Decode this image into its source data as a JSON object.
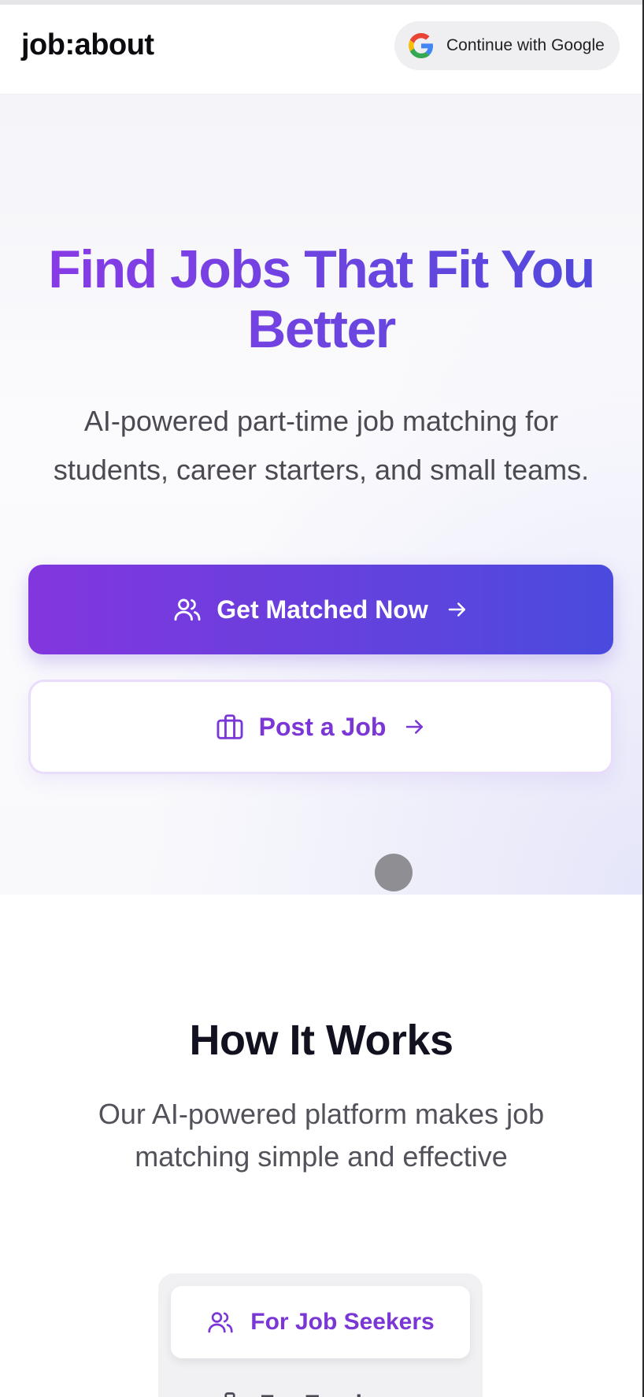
{
  "header": {
    "logo": "job:about",
    "google_button_label": "Continue with Google",
    "google_icon": "google-g-icon"
  },
  "hero": {
    "title": "Find Jobs That Fit You Better",
    "subtitle": "AI-powered part-time job matching for students, career starters, and small teams.",
    "primary_cta": {
      "label": "Get Matched Now",
      "icon": "users-icon",
      "trailing_icon": "arrow-right-icon"
    },
    "secondary_cta": {
      "label": "Post a Job",
      "icon": "briefcase-icon",
      "trailing_icon": "arrow-right-icon"
    }
  },
  "how_it_works": {
    "title": "How It Works",
    "subtitle": "Our AI-powered platform makes job matching simple and effective",
    "tabs": [
      {
        "label": "For Job Seekers",
        "icon": "users-icon",
        "active": true
      },
      {
        "label": "For Employers",
        "icon": "briefcase-icon",
        "active": false
      }
    ]
  },
  "colors": {
    "brand_purple": "#7b36d6",
    "gradient_start": "#8236de",
    "gradient_end": "#4a4bde",
    "heading_dark": "#111120"
  }
}
